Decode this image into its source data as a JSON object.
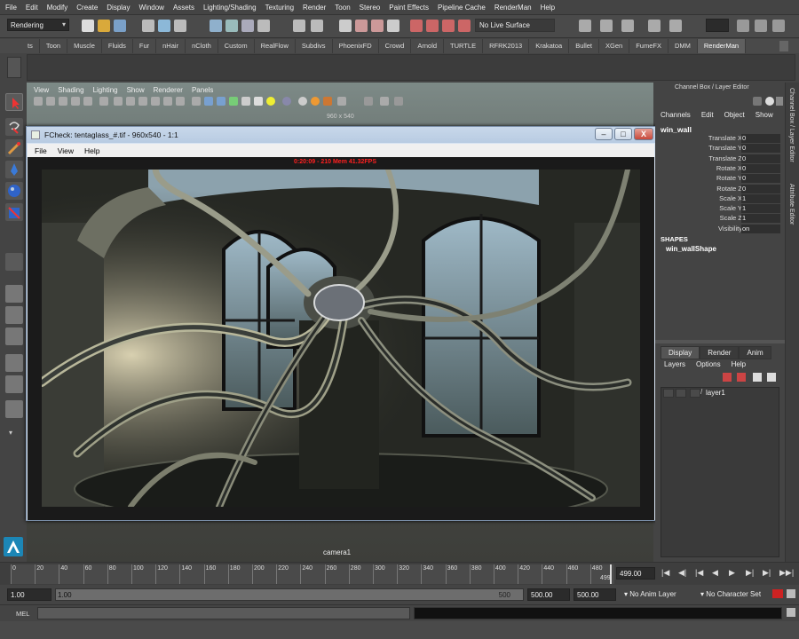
{
  "menubar": [
    "File",
    "Edit",
    "Modify",
    "Create",
    "Display",
    "Window",
    "Assets",
    "Lighting/Shading",
    "Texturing",
    "Render",
    "Toon",
    "Stereo",
    "Paint Effects",
    "Pipeline Cache",
    "RenderMan",
    "Help"
  ],
  "toolbar": {
    "mode": "Rendering",
    "live_surface": "No Live Surface"
  },
  "shelf_tabs": [
    "ts",
    "Toon",
    "Muscle",
    "Fluids",
    "Fur",
    "nHair",
    "nCloth",
    "Custom",
    "RealFlow",
    "Subdivs",
    "PhoenixFD",
    "Crowd",
    "Arnold",
    "TURTLE",
    "RFRK2013",
    "Krakatoa",
    "Bullet",
    "XGen",
    "FumeFX",
    "DMM",
    "RenderMan"
  ],
  "shelf_active": "RenderMan",
  "viewport": {
    "menu": [
      "View",
      "Shading",
      "Lighting",
      "Show",
      "Renderer",
      "Panels"
    ],
    "resolution": "960 x 540",
    "camera": "camera1"
  },
  "fcheck": {
    "title": "FCheck: tentaglass_#.tif - 960x540 - 1:1",
    "menu": [
      "File",
      "View",
      "Help"
    ],
    "status": "0:20:09 - 210  Mem 41.32FPS",
    "buttons": {
      "minimize": "–",
      "maximize": "□",
      "close": "X"
    }
  },
  "channel_box": {
    "title": "Channel Box / Layer Editor",
    "tabs": [
      "Channels",
      "Edit",
      "Object",
      "Show"
    ],
    "object": "win_wall",
    "attributes": [
      {
        "name": "Translate X",
        "value": "0"
      },
      {
        "name": "Translate Y",
        "value": "0"
      },
      {
        "name": "Translate Z",
        "value": "0"
      },
      {
        "name": "Rotate X",
        "value": "0"
      },
      {
        "name": "Rotate Y",
        "value": "0"
      },
      {
        "name": "Rotate Z",
        "value": "0"
      },
      {
        "name": "Scale X",
        "value": "1"
      },
      {
        "name": "Scale Y",
        "value": "1"
      },
      {
        "name": "Scale Z",
        "value": "1"
      },
      {
        "name": "Visibility",
        "value": "on"
      }
    ],
    "shapes_header": "SHAPES",
    "shape_name": "win_wallShape"
  },
  "layer_editor": {
    "tabs": [
      "Display",
      "Render",
      "Anim"
    ],
    "menu": [
      "Layers",
      "Options",
      "Help"
    ],
    "layers": [
      {
        "name": "layer1"
      }
    ]
  },
  "side_tabs": [
    "Channel Box / Layer Editor",
    "Attribute Editor"
  ],
  "timeline": {
    "ticks": [
      "0",
      "20",
      "40",
      "60",
      "80",
      "100",
      "120",
      "140",
      "160",
      "180",
      "200",
      "220",
      "240",
      "260",
      "280",
      "300",
      "320",
      "340",
      "360",
      "380",
      "400",
      "420",
      "440",
      "460",
      "480"
    ],
    "max_label": "499",
    "current_frame": "499.00",
    "controls": [
      "|◀",
      "◀|",
      "|◀",
      "◀",
      "▶",
      "▶|",
      "▶|",
      "▶▶|"
    ]
  },
  "range": {
    "start": "1.00",
    "inner_start": "1.00",
    "inner_end": "500",
    "end1": "500.00",
    "end2": "500.00",
    "anim_layer": "No Anim Layer",
    "character_set": "No Character Set"
  },
  "mel": {
    "label": "MEL"
  },
  "colors": {
    "accent_red": "#ff2020",
    "ui_bg": "#444444",
    "win_chrome": "#c8d8ea"
  }
}
